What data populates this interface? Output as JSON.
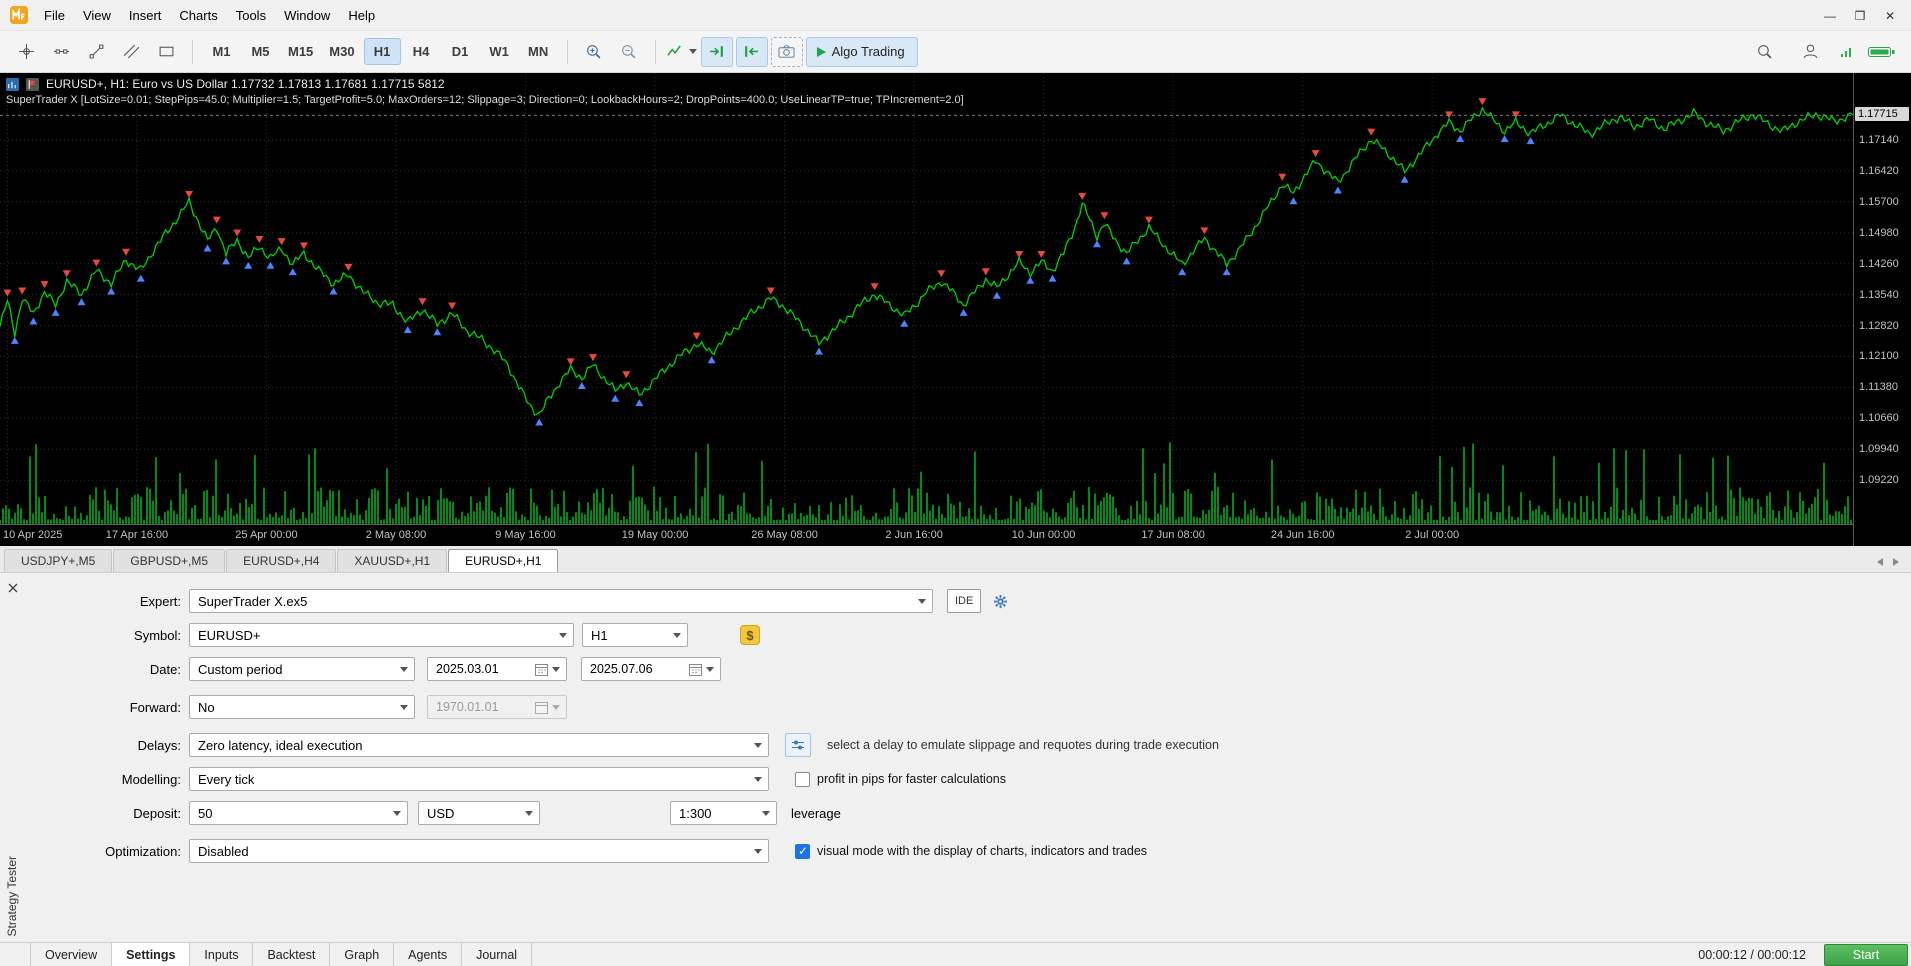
{
  "window": {
    "minimize": "—",
    "maximize": "❒",
    "close": "✕"
  },
  "menu": {
    "items": [
      "File",
      "View",
      "Insert",
      "Charts",
      "Tools",
      "Window",
      "Help"
    ]
  },
  "toolbar": {
    "timeframes": [
      "M1",
      "M5",
      "M15",
      "M30",
      "H1",
      "H4",
      "D1",
      "W1",
      "MN"
    ],
    "active_timeframe": "H1",
    "algo_trading": "Algo Trading"
  },
  "chart": {
    "title": "EURUSD+, H1:  Euro vs US Dollar   1.17732 1.17813 1.17681 1.17715  5812",
    "ea_params": "SuperTrader X [LotSize=0.01; StepPips=45.0; Multiplier=1.5; TargetProfit=5.0; MaxOrders=12; Slippage=3; Direction=0; LookbackHours=2; DropPoints=400.0; UseLinearTP=true; TPIncrement=2.0]",
    "current_price": "1.17715",
    "line_color": "#00d400",
    "sell_marker_color": "#e8493e",
    "buy_marker_color": "#4f82ff",
    "price_labels": [
      "1.17140",
      "1.16420",
      "1.15700",
      "1.14980",
      "1.14260",
      "1.13540",
      "1.12820",
      "1.12100",
      "1.11380",
      "1.10660",
      "1.09940",
      "1.09220"
    ],
    "time_labels": [
      "10 Apr 2025",
      "17 Apr 16:00",
      "25 Apr 00:00",
      "2 May 08:00",
      "9 May 16:00",
      "19 May 00:00",
      "26 May 08:00",
      "2 Jun 16:00",
      "10 Jun 00:00",
      "17 Jun 08:00",
      "24 Jun 16:00",
      "2 Jul 00:00"
    ],
    "chart_data": {
      "type": "line",
      "series_name": "EURUSD+ H1",
      "price_top": 1.187,
      "price_bottom": 1.082,
      "points": [
        [
          0.0,
          1.128
        ],
        [
          0.004,
          1.134
        ],
        [
          0.008,
          1.1265
        ],
        [
          0.012,
          1.1345
        ],
        [
          0.018,
          1.131
        ],
        [
          0.024,
          1.136
        ],
        [
          0.03,
          1.133
        ],
        [
          0.036,
          1.1385
        ],
        [
          0.044,
          1.1355
        ],
        [
          0.052,
          1.141
        ],
        [
          0.06,
          1.138
        ],
        [
          0.068,
          1.1435
        ],
        [
          0.076,
          1.141
        ],
        [
          0.084,
          1.1465
        ],
        [
          0.092,
          1.151
        ],
        [
          0.102,
          1.157
        ],
        [
          0.107,
          1.1525
        ],
        [
          0.112,
          1.148
        ],
        [
          0.117,
          1.151
        ],
        [
          0.122,
          1.145
        ],
        [
          0.128,
          1.148
        ],
        [
          0.134,
          1.144
        ],
        [
          0.14,
          1.1465
        ],
        [
          0.146,
          1.144
        ],
        [
          0.152,
          1.146
        ],
        [
          0.158,
          1.1425
        ],
        [
          0.164,
          1.145
        ],
        [
          0.172,
          1.141
        ],
        [
          0.18,
          1.138
        ],
        [
          0.188,
          1.14
        ],
        [
          0.196,
          1.136
        ],
        [
          0.204,
          1.1335
        ],
        [
          0.212,
          1.133
        ],
        [
          0.22,
          1.129
        ],
        [
          0.228,
          1.132
        ],
        [
          0.236,
          1.1285
        ],
        [
          0.244,
          1.131
        ],
        [
          0.252,
          1.127
        ],
        [
          0.26,
          1.125
        ],
        [
          0.268,
          1.122
        ],
        [
          0.274,
          1.119
        ],
        [
          0.28,
          1.114
        ],
        [
          0.286,
          1.1095
        ],
        [
          0.291,
          1.1075
        ],
        [
          0.296,
          1.111
        ],
        [
          0.302,
          1.115
        ],
        [
          0.308,
          1.118
        ],
        [
          0.314,
          1.116
        ],
        [
          0.32,
          1.119
        ],
        [
          0.326,
          1.116
        ],
        [
          0.332,
          1.113
        ],
        [
          0.338,
          1.115
        ],
        [
          0.345,
          1.112
        ],
        [
          0.352,
          1.115
        ],
        [
          0.36,
          1.1185
        ],
        [
          0.368,
          1.1215
        ],
        [
          0.376,
          1.124
        ],
        [
          0.384,
          1.122
        ],
        [
          0.392,
          1.1255
        ],
        [
          0.4,
          1.129
        ],
        [
          0.408,
          1.132
        ],
        [
          0.416,
          1.1345
        ],
        [
          0.422,
          1.133
        ],
        [
          0.428,
          1.1305
        ],
        [
          0.436,
          1.127
        ],
        [
          0.442,
          1.124
        ],
        [
          0.448,
          1.1265
        ],
        [
          0.456,
          1.1295
        ],
        [
          0.464,
          1.133
        ],
        [
          0.472,
          1.1355
        ],
        [
          0.48,
          1.133
        ],
        [
          0.488,
          1.1305
        ],
        [
          0.494,
          1.133
        ],
        [
          0.5,
          1.136
        ],
        [
          0.508,
          1.1385
        ],
        [
          0.514,
          1.136
        ],
        [
          0.52,
          1.133
        ],
        [
          0.526,
          1.136
        ],
        [
          0.532,
          1.139
        ],
        [
          0.538,
          1.137
        ],
        [
          0.544,
          1.14
        ],
        [
          0.55,
          1.143
        ],
        [
          0.556,
          1.1405
        ],
        [
          0.562,
          1.143
        ],
        [
          0.568,
          1.141
        ],
        [
          0.574,
          1.145
        ],
        [
          0.58,
          1.151
        ],
        [
          0.584,
          1.1565
        ],
        [
          0.588,
          1.153
        ],
        [
          0.592,
          1.149
        ],
        [
          0.596,
          1.152
        ],
        [
          0.602,
          1.148
        ],
        [
          0.608,
          1.145
        ],
        [
          0.614,
          1.148
        ],
        [
          0.62,
          1.151
        ],
        [
          0.626,
          1.148
        ],
        [
          0.632,
          1.145
        ],
        [
          0.638,
          1.1425
        ],
        [
          0.644,
          1.1455
        ],
        [
          0.65,
          1.1485
        ],
        [
          0.656,
          1.1455
        ],
        [
          0.662,
          1.1425
        ],
        [
          0.668,
          1.1455
        ],
        [
          0.674,
          1.149
        ],
        [
          0.68,
          1.153
        ],
        [
          0.686,
          1.157
        ],
        [
          0.692,
          1.161
        ],
        [
          0.698,
          1.159
        ],
        [
          0.704,
          1.163
        ],
        [
          0.71,
          1.1665
        ],
        [
          0.716,
          1.164
        ],
        [
          0.722,
          1.1615
        ],
        [
          0.728,
          1.165
        ],
        [
          0.734,
          1.1685
        ],
        [
          0.74,
          1.1715
        ],
        [
          0.746,
          1.1695
        ],
        [
          0.752,
          1.167
        ],
        [
          0.758,
          1.164
        ],
        [
          0.764,
          1.167
        ],
        [
          0.77,
          1.17
        ],
        [
          0.776,
          1.173
        ],
        [
          0.782,
          1.1755
        ],
        [
          0.788,
          1.1735
        ],
        [
          0.794,
          1.1762
        ],
        [
          0.8,
          1.1786
        ],
        [
          0.806,
          1.176
        ],
        [
          0.812,
          1.1735
        ],
        [
          0.818,
          1.1755
        ],
        [
          0.826,
          1.173
        ],
        [
          0.834,
          1.175
        ],
        [
          0.842,
          1.1772
        ],
        [
          0.85,
          1.175
        ],
        [
          0.858,
          1.1728
        ],
        [
          0.866,
          1.175
        ],
        [
          0.874,
          1.1768
        ],
        [
          0.882,
          1.1745
        ],
        [
          0.89,
          1.1762
        ],
        [
          0.898,
          1.174
        ],
        [
          0.906,
          1.1758
        ],
        [
          0.914,
          1.1776
        ],
        [
          0.922,
          1.1752
        ],
        [
          0.93,
          1.1735
        ],
        [
          0.938,
          1.1757
        ],
        [
          0.946,
          1.1774
        ],
        [
          0.954,
          1.1752
        ],
        [
          0.962,
          1.1734
        ],
        [
          0.97,
          1.1756
        ],
        [
          0.98,
          1.1774
        ],
        [
          0.99,
          1.1758
        ],
        [
          1.0,
          1.1772
        ]
      ]
    }
  },
  "chart_tabs": {
    "active": "EURUSD+,H1",
    "tabs": [
      "USDJPY+,M5",
      "GBPUSD+,M5",
      "EURUSD+,H4",
      "XAUUSD+,H1",
      "EURUSD+,H1"
    ]
  },
  "tester": {
    "panel_title": "Strategy Tester",
    "expert": {
      "label": "Expert:",
      "value": "SuperTrader X.ex5",
      "ide_button": "IDE"
    },
    "symbol": {
      "label": "Symbol:",
      "value": "EURUSD+",
      "timeframe": "H1",
      "dollar_icon": "$"
    },
    "date": {
      "label": "Date:",
      "mode": "Custom period",
      "from": "2025.03.01",
      "to": "2025.07.06"
    },
    "forward": {
      "label": "Forward:",
      "mode": "No",
      "date": "1970.01.01"
    },
    "delays": {
      "label": "Delays:",
      "value": "Zero latency, ideal execution",
      "hint": "select a delay to emulate slippage and requotes during trade execution"
    },
    "modelling": {
      "label": "Modelling:",
      "value": "Every tick",
      "checkbox": "profit in pips for faster calculations",
      "checked": false
    },
    "deposit": {
      "label": "Deposit:",
      "amount": "50",
      "currency": "USD",
      "leverage_value": "1:300",
      "leverage_label": "leverage"
    },
    "optimization": {
      "label": "Optimization:",
      "value": "Disabled",
      "checkbox": "visual mode with the display of charts, indicators and trades",
      "checked": true
    },
    "tabs": [
      "Overview",
      "Settings",
      "Inputs",
      "Backtest",
      "Graph",
      "Agents",
      "Journal"
    ],
    "active_tab": "Settings",
    "elapsed": "00:00:12 / 00:00:12",
    "start": "Start"
  }
}
